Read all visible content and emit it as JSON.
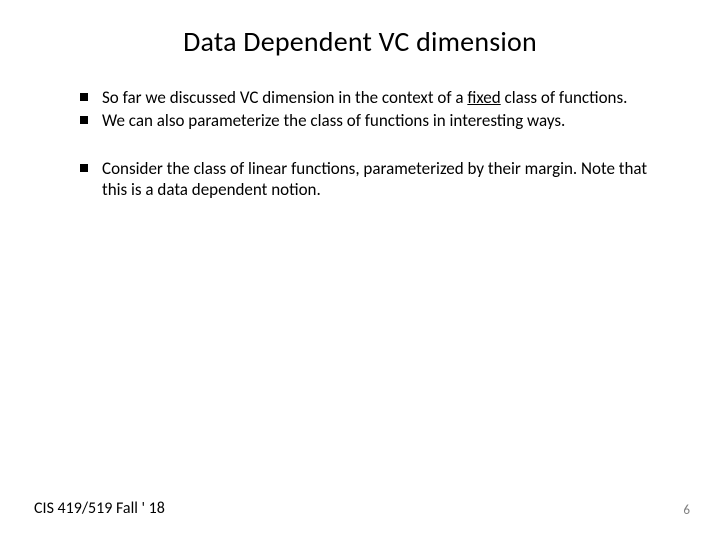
{
  "title": "Data Dependent VC dimension",
  "bullets": {
    "g0": {
      "b0": {
        "pre": "So far we discussed VC dimension in the context of a ",
        "u": "fixed",
        "post": " class of functions."
      },
      "b1": {
        "text": "We can also parameterize the class of functions in interesting ways."
      }
    },
    "g1": {
      "b0": {
        "text": "Consider the class of linear functions, parameterized by their margin. Note that this is a data dependent notion."
      }
    }
  },
  "footer": {
    "course": "CIS 419/519 Fall ' 18",
    "page": "6"
  }
}
